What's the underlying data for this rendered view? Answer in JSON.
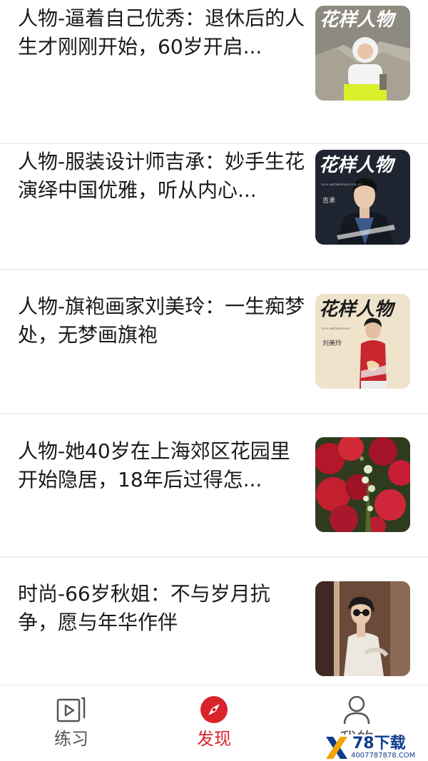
{
  "articles": [
    {
      "title": "人物-逼着自己优秀：退休后的人生才刚刚开始，60岁开启...",
      "thumb_text": "花样人物"
    },
    {
      "title": "人物-服装设计师吉承：妙手生花演绎中国优雅，听从内心...",
      "thumb_text": "花样人物",
      "thumb_sub": "2019 METROPOLIS VOL.37",
      "thumb_name": "吉承"
    },
    {
      "title": "人物-旗袍画家刘美玲：一生痴梦处，无梦画旗袍",
      "thumb_text": "花样人物",
      "thumb_sub": "2019 METROPOLIS",
      "thumb_name": "刘美玲"
    },
    {
      "title": "人物-她40岁在上海郊区花园里开始隐居，18年后过得怎..."
    },
    {
      "title": "时尚-66岁秋姐：不与岁月抗争，愿与年华作伴"
    }
  ],
  "tabbar": {
    "tabs": [
      {
        "label": "练习",
        "icon": "video-icon",
        "active": false
      },
      {
        "label": "发现",
        "icon": "compass-icon",
        "active": true
      },
      {
        "label": "我的",
        "icon": "person-icon",
        "active": false
      }
    ]
  },
  "watermark": {
    "title": "78下载",
    "url": "4007787878.COM"
  },
  "colors": {
    "accent": "#d9232b",
    "text": "#1a1a1a",
    "tab_inactive": "#555555",
    "divider": "#eeeeee"
  }
}
